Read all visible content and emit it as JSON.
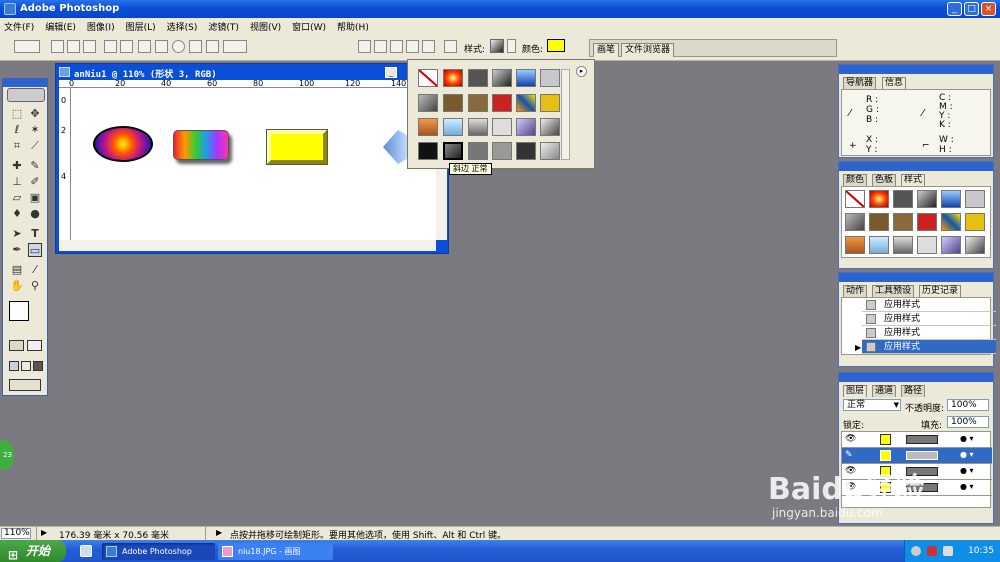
{
  "window": {
    "title": "Adobe Photoshop",
    "btn_min": "_",
    "btn_max": "□",
    "btn_close": "×"
  },
  "menu": [
    "文件(F)",
    "编辑(E)",
    "图像(I)",
    "图层(L)",
    "选择(S)",
    "滤镜(T)",
    "视图(V)",
    "窗口(W)",
    "帮助(H)"
  ],
  "options": {
    "style_label": "样式:",
    "color_label": "颜色:",
    "color_value": "#ffff00"
  },
  "palette_well": [
    "画笔",
    "文件浏览器"
  ],
  "document": {
    "title": "anNiu1 @ 110% (形状 3, RGB)",
    "ruler_top": [
      "0",
      "20",
      "40",
      "60",
      "80",
      "100",
      "120",
      "140"
    ],
    "ruler_left": [
      "0",
      "2",
      "4"
    ]
  },
  "style_flyout": {
    "tooltip": "斜边 正常"
  },
  "navigator_panel": {
    "tabs": [
      "导航器",
      "信息"
    ],
    "labels": [
      "R :",
      "G :",
      "B :",
      "C :",
      "M :",
      "Y :",
      "K :",
      "X :",
      "Y :",
      "W :",
      "H :"
    ]
  },
  "color_panel": {
    "tabs": [
      "颜色",
      "色板",
      "样式"
    ]
  },
  "history_panel": {
    "tabs": [
      "动作",
      "工具预设",
      "历史记录"
    ],
    "items": [
      "应用样式",
      "应用样式",
      "应用样式",
      "应用样式"
    ]
  },
  "layers_panel": {
    "tabs": [
      "图层",
      "通道",
      "路径"
    ],
    "blend_mode": "正常",
    "opacity_label": "不透明度:",
    "opacity": "100%",
    "lock_label": "锁定:",
    "fill_label": "填充:",
    "fill": "100%"
  },
  "status": {
    "zoom": "110%",
    "doc_size": "176.39 毫米 x 70.56 毫米",
    "hint": "点按并拖移可绘制矩形。要用其他选项，使用 Shift、Alt 和 Ctrl 键。"
  },
  "taskbar": {
    "start": "开始",
    "tasks": [
      "Adobe Photoshop",
      "niu18.JPG - 画图"
    ],
    "time": "10:35"
  },
  "overlay": {
    "circle_text": "23",
    "watermark_1": "Baidu经验",
    "watermark_2": "jingyan.baidu.com"
  }
}
